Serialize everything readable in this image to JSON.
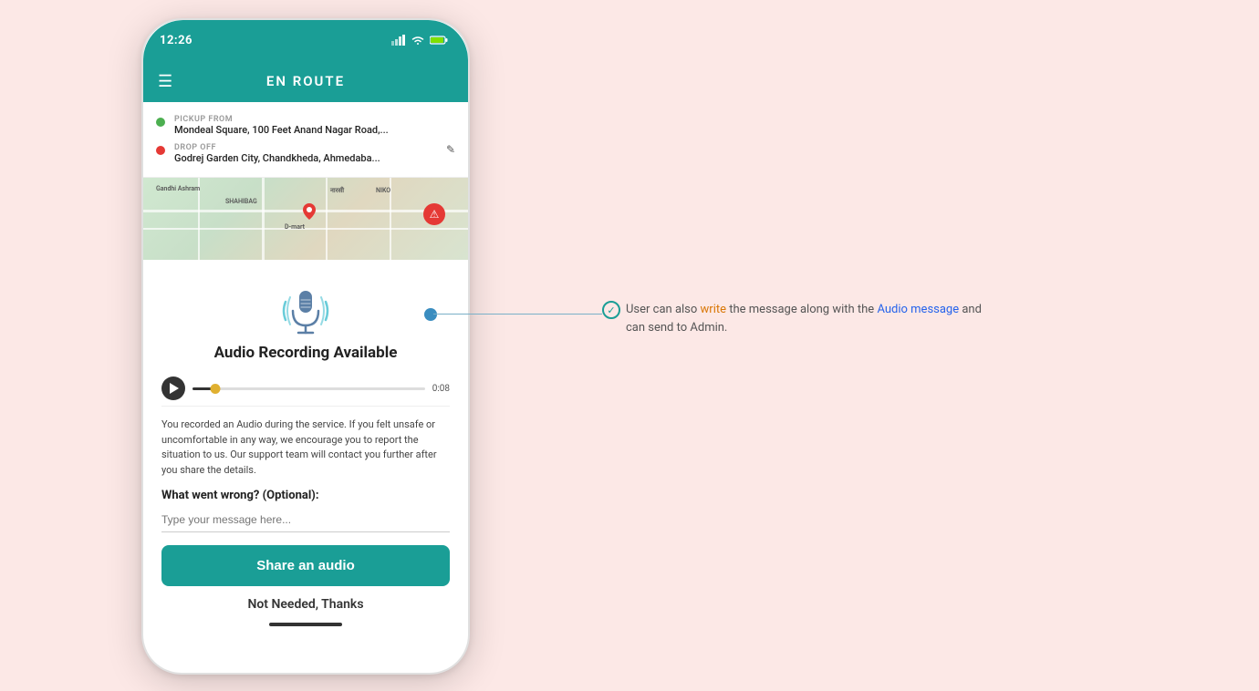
{
  "page": {
    "background": "#fce8e6"
  },
  "phone": {
    "status_bar": {
      "time": "12:26",
      "icons": [
        "signal",
        "wifi",
        "battery"
      ]
    },
    "nav": {
      "title": "EN ROUTE",
      "menu_icon": "☰"
    },
    "route": {
      "pickup_label": "PICKUP FROM",
      "pickup_address": "Mondeal Square, 100 Feet Anand Nagar Road,...",
      "dropoff_label": "DROP OFF",
      "dropoff_address": "Godrej Garden City, Chandkheda, Ahmedaba...",
      "edit_icon": "✎"
    },
    "audio_section": {
      "title": "Audio Recording Available",
      "player": {
        "time": "0:08"
      },
      "description": "You recorded an Audio during the service. If you felt unsafe or uncomfortable in any way, we encourage you to report the situation to us. Our support team will contact you further after you share the details.",
      "what_went_wrong": "What went wrong? (Optional):",
      "input_placeholder": "Type your message here...",
      "share_button": "Share an audio",
      "not_needed": "Not Needed, Thanks"
    }
  },
  "callout": {
    "text": "User can also write the message along with the Audio message and can send to Admin.",
    "highlights": {
      "write": "write",
      "audio_message": "Audio message"
    }
  }
}
